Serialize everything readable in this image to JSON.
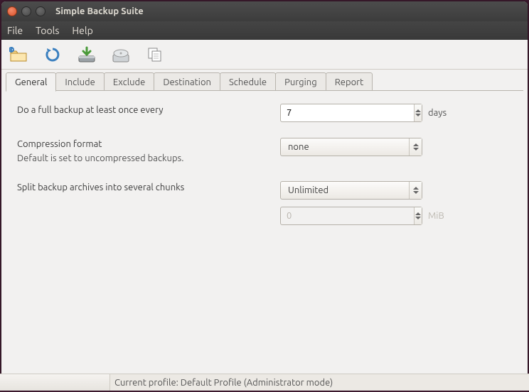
{
  "window": {
    "title": "Simple Backup Suite"
  },
  "menu": {
    "file": "File",
    "tools": "Tools",
    "help": "Help"
  },
  "toolbar_icons": {
    "open": "open-folder-icon",
    "reload": "reload-icon",
    "backup": "backup-icon",
    "disk": "disk-icon",
    "copy": "copy-icon"
  },
  "tabs": [
    {
      "label": "General"
    },
    {
      "label": "Include"
    },
    {
      "label": "Exclude"
    },
    {
      "label": "Destination"
    },
    {
      "label": "Schedule"
    },
    {
      "label": "Purging"
    },
    {
      "label": "Report"
    }
  ],
  "general": {
    "full_backup_label": "Do a full backup at least once every",
    "full_backup_value": "7",
    "full_backup_unit": "days",
    "compression_label": "Compression format",
    "compression_sub": "Default is set to uncompressed backups.",
    "compression_value": "none",
    "split_label": "Split backup archives into several chunks",
    "split_value": "Unlimited",
    "split_size_value": "0",
    "split_size_unit": "MiB"
  },
  "status": {
    "text": "Current profile: Default Profile   (Administrator mode)"
  }
}
